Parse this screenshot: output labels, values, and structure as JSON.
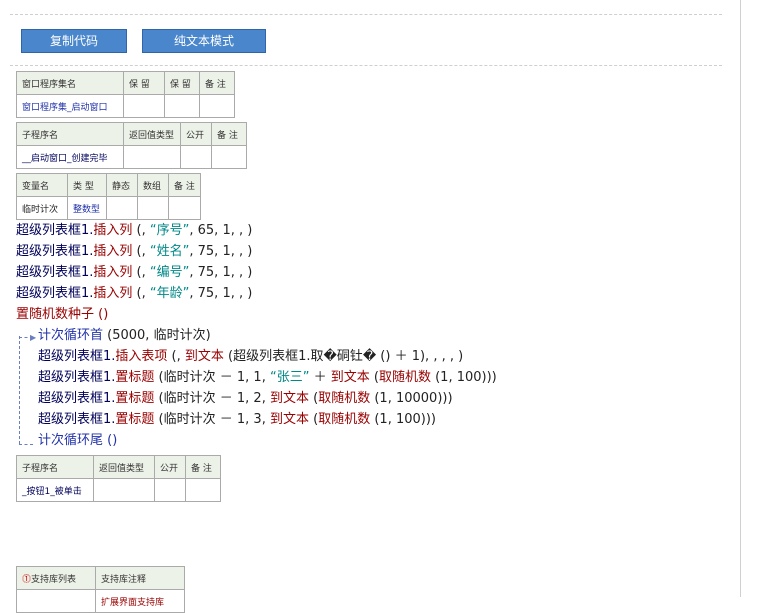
{
  "toolbar": {
    "copy_code": "复制代码",
    "text_mode": "纯文本模式"
  },
  "window_table": {
    "headers": [
      "窗口程序集名",
      "保 留",
      "保 留",
      "备 注"
    ],
    "row": [
      "窗口程序集_启动窗口",
      "",
      "",
      ""
    ]
  },
  "sub1_table": {
    "headers": [
      "子程序名",
      "返回值类型",
      "公开",
      "备 注"
    ],
    "row": [
      "__启动窗口_创建完毕",
      "",
      "",
      ""
    ]
  },
  "var_table": {
    "headers": [
      "变量名",
      "类 型",
      "静态",
      "数组",
      "备 注"
    ],
    "row": [
      "临时计次",
      "整数型",
      "",
      "",
      ""
    ]
  },
  "code": {
    "insert_cols": [
      {
        "obj": "超级列表框1.",
        "method": "插入列",
        "open": " (, ",
        "str": "“序号”",
        "rest": ", 65, 1, , )"
      },
      {
        "obj": "超级列表框1.",
        "method": "插入列",
        "open": " (, ",
        "str": "“姓名”",
        "rest": ", 75, 1, , )"
      },
      {
        "obj": "超级列表框1.",
        "method": "插入列",
        "open": " (, ",
        "str": "“编号”",
        "rest": ", 75, 1, , )"
      },
      {
        "obj": "超级列表框1.",
        "method": "插入列",
        "open": " (, ",
        "str": "“年龄”",
        "rest": ", 75, 1, , )"
      }
    ],
    "seed": "置随机数种子 ()",
    "loop_head": "计次循环首",
    "loop_head_args": " (5000, 临时计次)",
    "insert_item": {
      "obj": "超级列表框1.",
      "method": "插入表项",
      "p1": " (, ",
      "fn": "到文本",
      "p2": " (超级列表框1.取�硐钍� () ＋ 1), , , , )"
    },
    "set_title_1": {
      "obj": "超级列表框1.",
      "method": "置标题",
      "p1": " (临时计次 － 1, 1, ",
      "str": "“张三”",
      "p2": " ＋ ",
      "fn": "到文本",
      "p3": " (",
      "fn2": "取随机数",
      "p4": " (1, 100)))"
    },
    "set_title_2": {
      "obj": "超级列表框1.",
      "method": "置标题",
      "p1": " (临时计次 － 1, 2, ",
      "fn": "到文本",
      "p2": " (",
      "fn2": "取随机数",
      "p3": " (1, 10000)))"
    },
    "set_title_3": {
      "obj": "超级列表框1.",
      "method": "置标题",
      "p1": " (临时计次 － 1, 3, ",
      "fn": "到文本",
      "p2": " (",
      "fn2": "取随机数",
      "p3": " (1, 100)))"
    },
    "loop_tail": "计次循环尾 ()"
  },
  "sub2_table": {
    "headers": [
      "子程序名",
      "返回值类型",
      "公开",
      "备 注"
    ],
    "row": [
      "_按钮1_被单击",
      "",
      "",
      ""
    ]
  },
  "lib_table": {
    "headers": [
      "支持库列表",
      "支持库注释"
    ],
    "warn_icon": "warning-icon",
    "partial_row": "扩展界面支持库"
  },
  "colors": {
    "button_blue": "#4a86cc",
    "header_bg": "#edf2e8",
    "function_red": "#990000",
    "keyword_blue": "#2233aa",
    "string_teal": "#008888"
  }
}
